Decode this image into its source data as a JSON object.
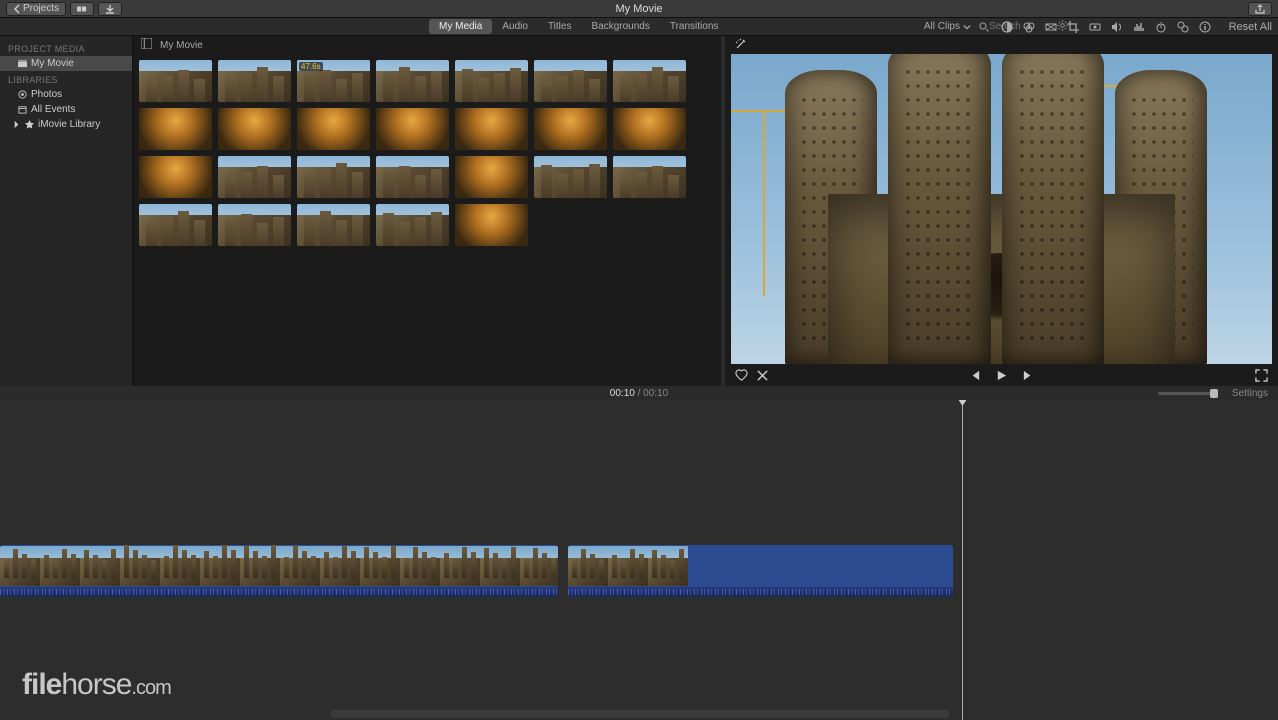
{
  "titlebar": {
    "back_label": "Projects",
    "title": "My Movie"
  },
  "tabs": {
    "items": [
      "My Media",
      "Audio",
      "Titles",
      "Backgrounds",
      "Transitions"
    ],
    "active_index": 0,
    "filter_label": "All Clips",
    "search_placeholder": "Search"
  },
  "adjust": {
    "reset_label": "Reset All"
  },
  "sidebar": {
    "section1_label": "PROJECT MEDIA",
    "project_name": "My Movie",
    "section2_label": "LIBRARIES",
    "items": [
      "Photos",
      "All Events",
      "iMovie Library"
    ]
  },
  "browser": {
    "crumb": "My Movie",
    "thumb_count": 26,
    "selected_index": 2,
    "badge_text": "47.6s",
    "interior_indices": [
      7,
      8,
      9,
      10,
      11,
      12,
      13,
      14,
      18,
      25
    ],
    "row_counts": [
      7,
      7,
      7,
      5
    ]
  },
  "preview_controls": {
    "labels": {
      "favorite": "Favorite",
      "reject": "Reject",
      "prev": "Previous",
      "play": "Play",
      "next": "Next",
      "fullscreen": "Fullscreen"
    }
  },
  "timecode": {
    "current": "00:10",
    "sep": " / ",
    "total": "00:10",
    "settings_label": "Settings"
  },
  "timeline": {
    "clip1_frames": 14,
    "clip2_frames": 3
  },
  "watermark": {
    "brand_a": "file",
    "brand_b": "horse",
    "tld": "com"
  }
}
